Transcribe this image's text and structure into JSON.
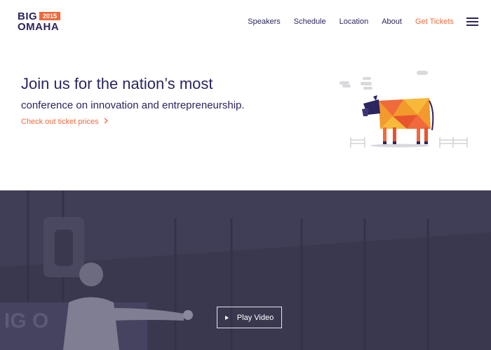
{
  "logo": {
    "top": "BIG",
    "year": "2015",
    "bottom": "OMAHA"
  },
  "nav": {
    "items": [
      {
        "label": "Speakers"
      },
      {
        "label": "Schedule"
      },
      {
        "label": "Location"
      },
      {
        "label": "About"
      },
      {
        "label": "Get Tickets"
      }
    ],
    "menu_icon": "hamburger-icon"
  },
  "hero": {
    "headline": "Join us for the nation’s most",
    "subheadline": "conference on innovation and entrepreneurship.",
    "link": "Check out ticket prices",
    "illustration": "geometric-cow-illustration"
  },
  "video": {
    "play_label": "Play Video",
    "play_icon": "play-icon"
  },
  "colors": {
    "navy": "#2b2560",
    "accent": "#f06a3b",
    "video_bg": "#38364d"
  }
}
